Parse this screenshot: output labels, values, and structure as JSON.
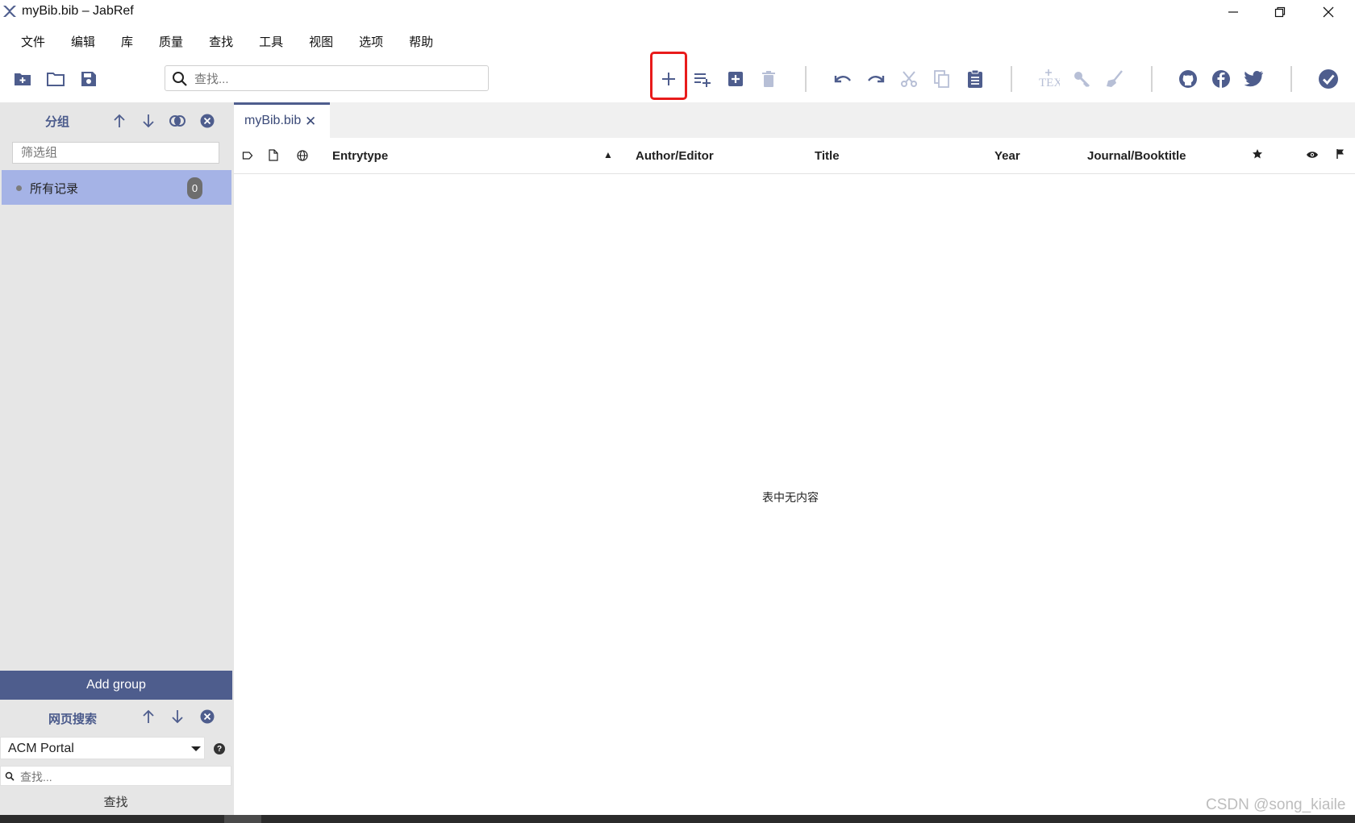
{
  "window": {
    "title": "myBib.bib – JabRef",
    "controls": [
      "minimize-icon",
      "restore-icon",
      "close-icon"
    ]
  },
  "menu": [
    "文件",
    "编辑",
    "库",
    "质量",
    "查找",
    "工具",
    "视图",
    "选项",
    "帮助"
  ],
  "toolbar": {
    "search_placeholder": "查找...",
    "left_icons": [
      "new-library-icon",
      "open-library-icon",
      "save-library-icon"
    ],
    "entry_icons": [
      "add-entry-icon",
      "add-entry-from-id-icon",
      "new-entry-plus-icon",
      "delete-entry-icon"
    ],
    "edit_icons": [
      "undo-icon",
      "redo-icon",
      "cut-icon",
      "copy-icon",
      "paste-icon"
    ],
    "tool_icons": [
      "tex-icon",
      "key-icon",
      "cleanup-icon"
    ],
    "social_icons": [
      "github-icon",
      "facebook-icon",
      "twitter-icon"
    ],
    "right_icon": "check-circle-icon",
    "highlighted_button": "add-entry-icon",
    "highlight_color": "#e81b1b"
  },
  "groups": {
    "title": "分组",
    "filter_placeholder": "筛选组",
    "items": [
      {
        "label": "所有记录",
        "count": "0"
      }
    ],
    "add_group_label": "Add group"
  },
  "web_search": {
    "title": "网页搜索",
    "fetcher": "ACM Portal",
    "search_placeholder": "查找...",
    "search_button": "查找"
  },
  "tabs": [
    {
      "label": "myBib.bib",
      "close": "✕"
    }
  ],
  "table": {
    "columns": [
      "Entrytype",
      "Author/Editor",
      "Title",
      "Year",
      "Journal/Booktitle"
    ],
    "sort_indicator": "▲",
    "empty_message": "表中无内容"
  },
  "watermark": "CSDN @song_kiaile",
  "colors": {
    "accent": "#4e5d8d",
    "selected_row": "#a5b3e6",
    "icon": "#4e5d8d",
    "icon_disabled": "#b7bfd6"
  }
}
